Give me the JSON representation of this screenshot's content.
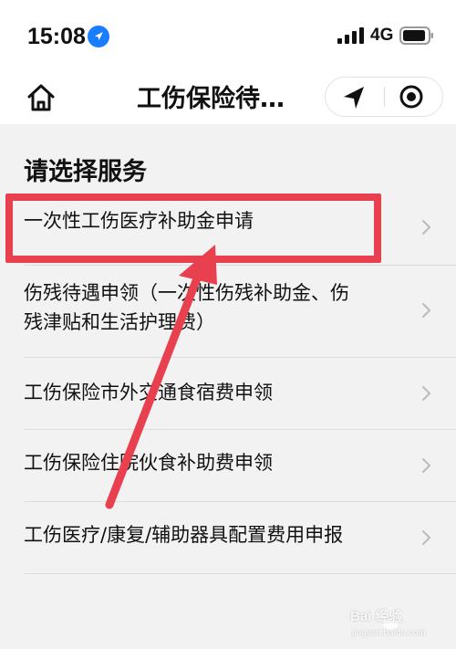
{
  "status_bar": {
    "time": "15:08",
    "network": "4G",
    "location_icon": "location-arrow-icon",
    "signal_icon": "cellular-signal-icon",
    "battery_icon": "battery-icon"
  },
  "nav_bar": {
    "title": "工伤保险待…",
    "home_icon": "home-icon",
    "capsule": {
      "left_icon": "navigation-arrow-icon",
      "right_icon": "close-circle-icon"
    }
  },
  "section": {
    "title": "请选择服务"
  },
  "services": [
    {
      "label_lines": [
        "一次性工伤医疗补助金申请"
      ]
    },
    {
      "label_lines": [
        "伤残待遇申领（一次性伤残补助金、伤",
        "残津贴和生活护理费）"
      ]
    },
    {
      "label_lines": [
        "工伤保险市外交通食宿费申领"
      ]
    },
    {
      "label_lines": [
        "工伤保险住院伙食补助费申领"
      ]
    },
    {
      "label_lines": [
        "工伤医疗/康复/辅助器具配置费用申报"
      ]
    }
  ],
  "annotation": {
    "highlight_color": "#e8404f",
    "highlighted_index": 0
  },
  "watermark": {
    "text": "Bai 经验",
    "sub": "jingyan.baidu.com"
  }
}
